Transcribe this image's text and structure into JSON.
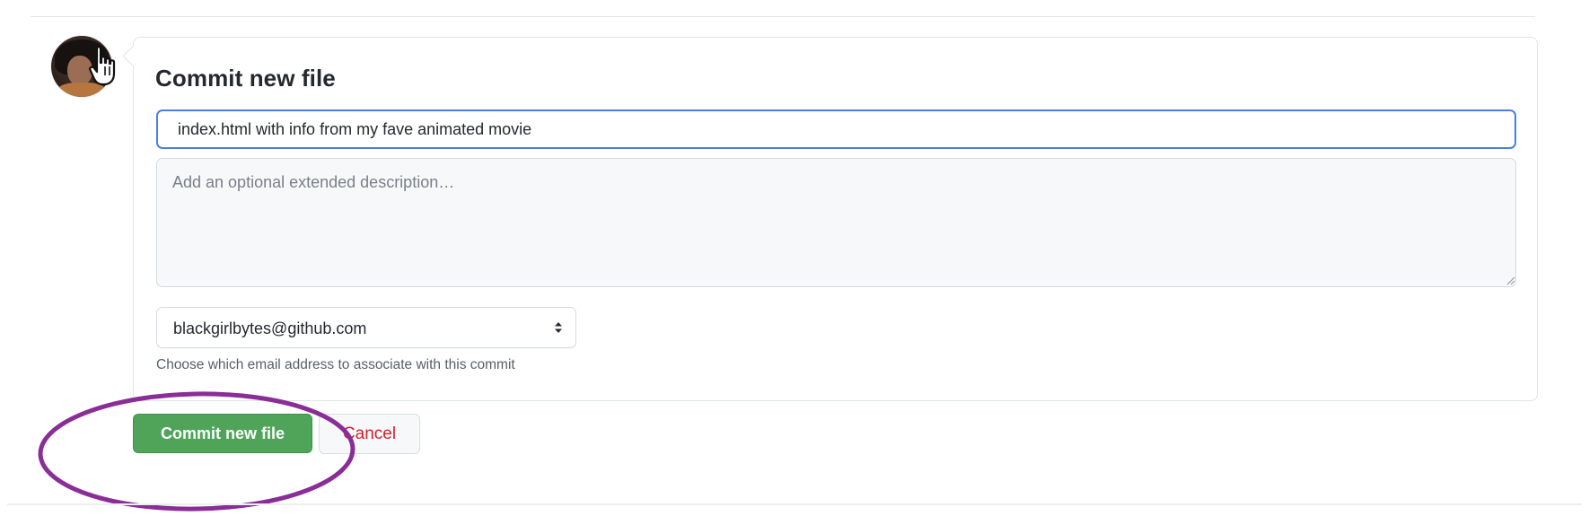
{
  "commit_form": {
    "title": "Commit new file",
    "summary_value": "index.html with info from my fave animated movie",
    "description_placeholder": "Add an optional extended description…",
    "email_selected": "blackgirlbytes@github.com",
    "email_note": "Choose which email address to associate with this commit"
  },
  "actions": {
    "commit_label": "Commit new file",
    "cancel_label": "Cancel"
  },
  "colors": {
    "commit_button": "#4fa45a",
    "cancel_text": "#cf222e",
    "focus_border": "#4a7fe0",
    "annotation_ellipse": "#8a2d97"
  },
  "icons": {
    "cursor": "pointer-hand-icon",
    "select_caret": "select-caret-icon",
    "resize": "resize-grip-icon"
  }
}
